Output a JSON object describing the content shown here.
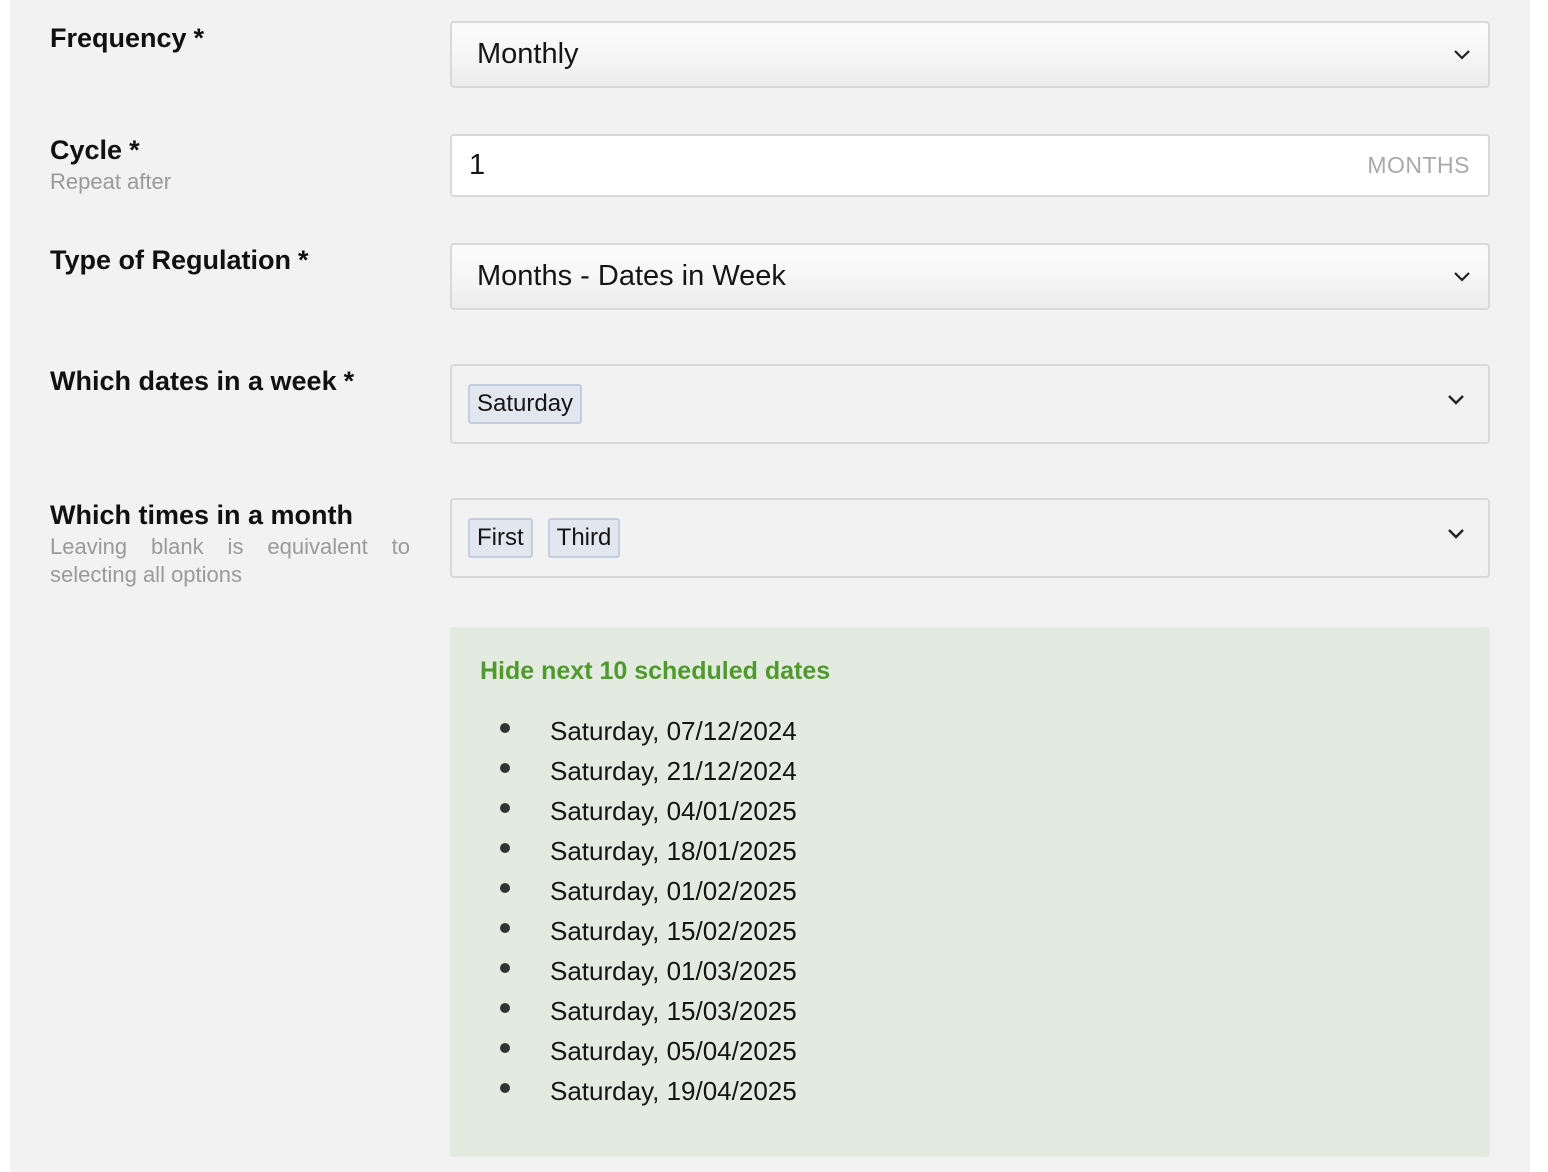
{
  "frequency": {
    "label": "Frequency",
    "required_mark": "*",
    "value": "Monthly"
  },
  "cycle": {
    "label": "Cycle",
    "required_mark": "*",
    "help": "Repeat after",
    "value": "1",
    "suffix": "MONTHS"
  },
  "regulation": {
    "label": "Type of Regulation",
    "required_mark": "*",
    "value": "Months - Dates in Week"
  },
  "dates_in_week": {
    "label": "Which dates in a week",
    "required_mark": "*",
    "tags": [
      "Saturday"
    ]
  },
  "times_in_month": {
    "label": "Which times in a month",
    "help": "Leaving blank is equivalent to selecting all options",
    "tags": [
      "First",
      "Third"
    ]
  },
  "schedule": {
    "toggle_label": "Hide next 10 scheduled dates",
    "dates": [
      "Saturday, 07/12/2024",
      "Saturday, 21/12/2024",
      "Saturday, 04/01/2025",
      "Saturday, 18/01/2025",
      "Saturday, 01/02/2025",
      "Saturday, 15/02/2025",
      "Saturday, 01/03/2025",
      "Saturday, 15/03/2025",
      "Saturday, 05/04/2025",
      "Saturday, 19/04/2025"
    ]
  },
  "icons": {
    "dropdown": "chevron-down-icon"
  },
  "colors": {
    "panel_background": "#f2f2f2",
    "schedule_background": "#e3ebe0",
    "schedule_link": "#4f9a2c",
    "tag_background": "#e2e7ef"
  }
}
